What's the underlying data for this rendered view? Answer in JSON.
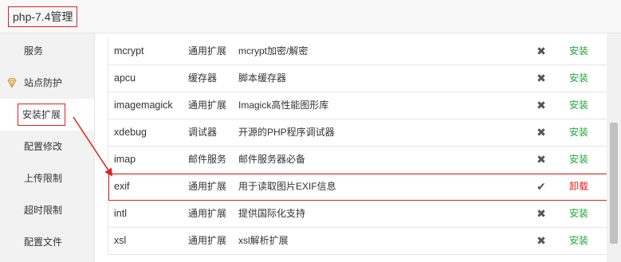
{
  "window": {
    "title": "php-7.4管理"
  },
  "sidebar": {
    "items": [
      {
        "label": "服务"
      },
      {
        "label": "站点防护"
      },
      {
        "label": "安装扩展"
      },
      {
        "label": "配置修改"
      },
      {
        "label": "上传限制"
      },
      {
        "label": "超时限制"
      },
      {
        "label": "配置文件"
      }
    ]
  },
  "extensions": [
    {
      "name": "mcrypt",
      "type": "通用扩展",
      "desc": "mcrypt加密/解密",
      "status": "✖",
      "action": "安装"
    },
    {
      "name": "apcu",
      "type": "缓存器",
      "desc": "脚本缓存器",
      "status": "✖",
      "action": "安装"
    },
    {
      "name": "imagemagick",
      "type": "通用扩展",
      "desc": "Imagick高性能图形库",
      "status": "✖",
      "action": "安装"
    },
    {
      "name": "xdebug",
      "type": "调试器",
      "desc": "开源的PHP程序调试器",
      "status": "✖",
      "action": "安装"
    },
    {
      "name": "imap",
      "type": "邮件服务",
      "desc": "邮件服务器必备",
      "status": "✖",
      "action": "安装"
    },
    {
      "name": "exif",
      "type": "通用扩展",
      "desc": "用于读取图片EXIF信息",
      "status": "✔",
      "action": "卸载"
    },
    {
      "name": "intl",
      "type": "通用扩展",
      "desc": "提供国际化支持",
      "status": "✖",
      "action": "安装"
    },
    {
      "name": "xsl",
      "type": "通用扩展",
      "desc": "xsl解析扩展",
      "status": "✖",
      "action": "安装"
    }
  ],
  "colors": {
    "install": "#20a53a",
    "uninstall": "#e02020",
    "annotation": "#e02020"
  },
  "icons": {
    "site_protection": "diamond-shield-icon",
    "not_installed": "cross-icon",
    "installed": "check-icon"
  }
}
